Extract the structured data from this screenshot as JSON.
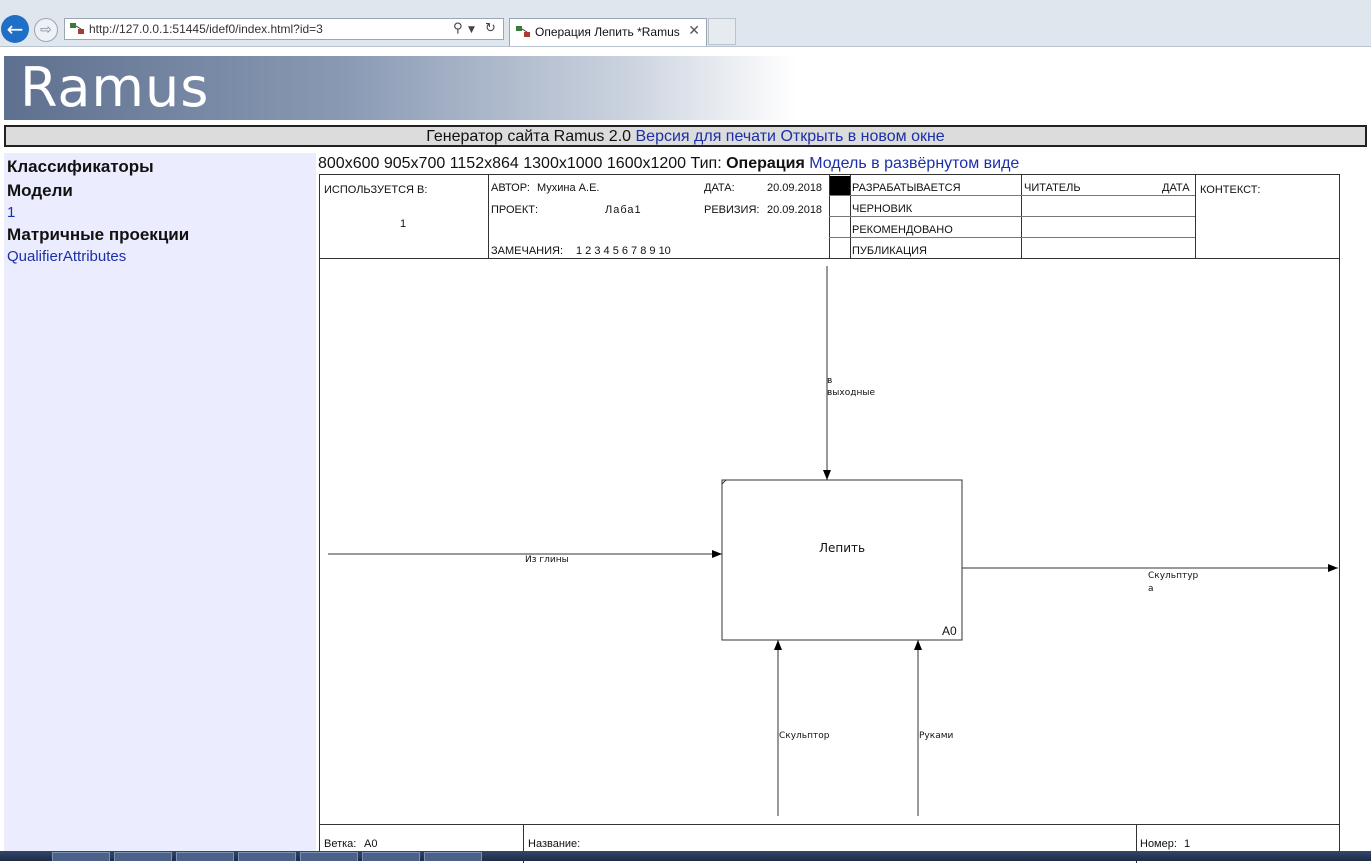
{
  "browser": {
    "url": "http://127.0.0.1:51445/idef0/index.html?id=3",
    "tab_title": "Операция Лепить *Ramus",
    "tab_close": "✕",
    "back_icon": "←",
    "forward_icon": "⇨"
  },
  "banner": {
    "logo": "Ramus"
  },
  "genbar": {
    "text": "Генератор сайта Ramus 2.0",
    "print_link": "Версия для печати",
    "new_window_link": "Открыть в новом окне"
  },
  "sidebar": {
    "classifiers": "Классификаторы",
    "models": "Модели",
    "model_link": "1",
    "matrix": "Матричные проекции",
    "qualifier_link": "QualifierAttributes"
  },
  "toolbar": {
    "sizes": [
      "800x600",
      "905x700",
      "1152x864",
      "1300x1000",
      "1600x1200"
    ],
    "type_label": "Тип:",
    "type_value": "Операция",
    "view_link": "Модель в развёрнутом виде"
  },
  "header": {
    "used_in_label": "ИСПОЛЬЗУЕТСЯ В:",
    "used_in_value": "1",
    "author_label": "АВТОР:",
    "author_value": "Мухина А.Е.",
    "project_label": "ПРОЕКТ:",
    "project_value": "Лаба1",
    "notes_label": "ЗАМЕЧАНИЯ:",
    "notes_numbers": "1 2 3 4 5 6 7 8 9 10",
    "date_label": "ДАТА:",
    "date_value": "20.09.2018",
    "revision_label": "РЕВИЗИЯ:",
    "revision_value": "20.09.2018",
    "status": [
      "РАЗРАБАТЫВАЕТСЯ",
      "ЧЕРНОВИК",
      "РЕКОМЕНДОВАНО",
      "ПУБЛИКАЦИЯ"
    ],
    "reader_label": "ЧИТАТЕЛЬ",
    "reader_date_label": "ДАТА",
    "context_label": "КОНТЕКСТ:"
  },
  "diagram": {
    "box_label": "Лепить",
    "box_id": "A0",
    "control_label_line1": "в",
    "control_label_line2": "выходные",
    "input_label": "Из глины",
    "output_label_line1": "Скульптур",
    "output_label_line2": "а",
    "mechanism1_label": "Скульптор",
    "mechanism2_label": "Руками"
  },
  "footer": {
    "branch_label": "Ветка:",
    "branch_value": "A0",
    "name_label": "Название:",
    "number_label": "Номер:",
    "number_value": "1"
  }
}
